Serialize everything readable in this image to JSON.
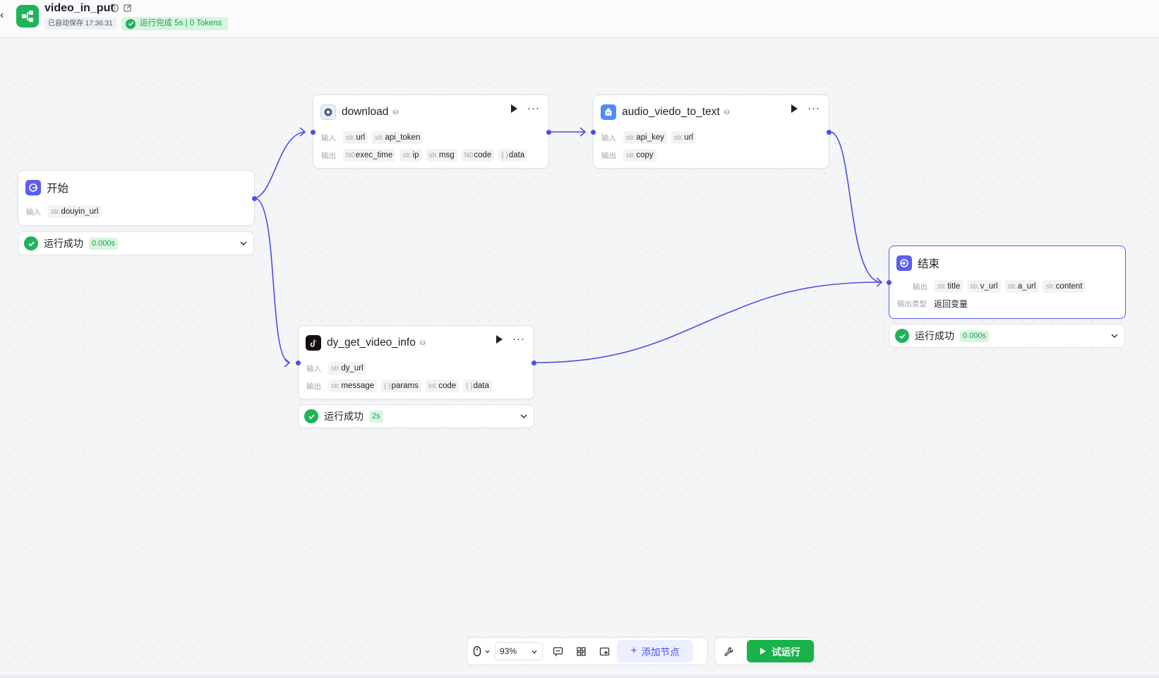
{
  "header": {
    "back_icon": "chevron-left-icon",
    "title": "video_in_put",
    "autosave": "已自动保存 17:36:31",
    "run_status": "运行完成 5s | 0 Tokens"
  },
  "nodes": {
    "start": {
      "title": "开始",
      "input_label": "输入",
      "inputs": [
        {
          "type": "str.",
          "name": "douyin_url"
        }
      ],
      "result": {
        "text": "运行成功",
        "duration": "0.000s"
      }
    },
    "download": {
      "title": "download",
      "input_label": "输入",
      "output_label": "输出",
      "inputs": [
        {
          "type": "str.",
          "name": "url"
        },
        {
          "type": "str.",
          "name": "api_token"
        }
      ],
      "outputs": [
        {
          "type": "N0",
          "name": "exec_time"
        },
        {
          "type": "str.",
          "name": "ip"
        },
        {
          "type": "str.",
          "name": "msg"
        },
        {
          "type": "N0",
          "name": "code"
        },
        {
          "type": "{ }",
          "name": "data"
        }
      ]
    },
    "audio": {
      "title": "audio_viedo_to_text",
      "input_label": "输入",
      "output_label": "输出",
      "inputs": [
        {
          "type": "str.",
          "name": "api_key"
        },
        {
          "type": "str.",
          "name": "url"
        }
      ],
      "outputs": [
        {
          "type": "str.",
          "name": "copy"
        }
      ]
    },
    "dy": {
      "title": "dy_get_video_info",
      "input_label": "输入",
      "output_label": "输出",
      "inputs": [
        {
          "type": "str.",
          "name": "dy_url"
        }
      ],
      "outputs": [
        {
          "type": "str.",
          "name": "message"
        },
        {
          "type": "{ }",
          "name": "params"
        },
        {
          "type": "int.",
          "name": "code"
        },
        {
          "type": "{ }",
          "name": "data"
        }
      ],
      "result": {
        "text": "运行成功",
        "duration": "2s"
      }
    },
    "end": {
      "title": "结束",
      "output_label": "输出",
      "outputs": [
        {
          "type": "str.",
          "name": "title"
        },
        {
          "type": "str.",
          "name": "v_url"
        },
        {
          "type": "str.",
          "name": "a_url"
        },
        {
          "type": "str.",
          "name": "content"
        }
      ],
      "output_type_label": "输出类型",
      "output_type_value": "返回变量",
      "result": {
        "text": "运行成功",
        "duration": "0.000s"
      }
    }
  },
  "toolbar": {
    "zoom": "93%",
    "add_node": "添加节点",
    "trial_run": "试运行"
  },
  "colors": {
    "accent": "#4a4ee8",
    "success": "#1fb35a",
    "trial_run_bg": "#19b24b"
  }
}
